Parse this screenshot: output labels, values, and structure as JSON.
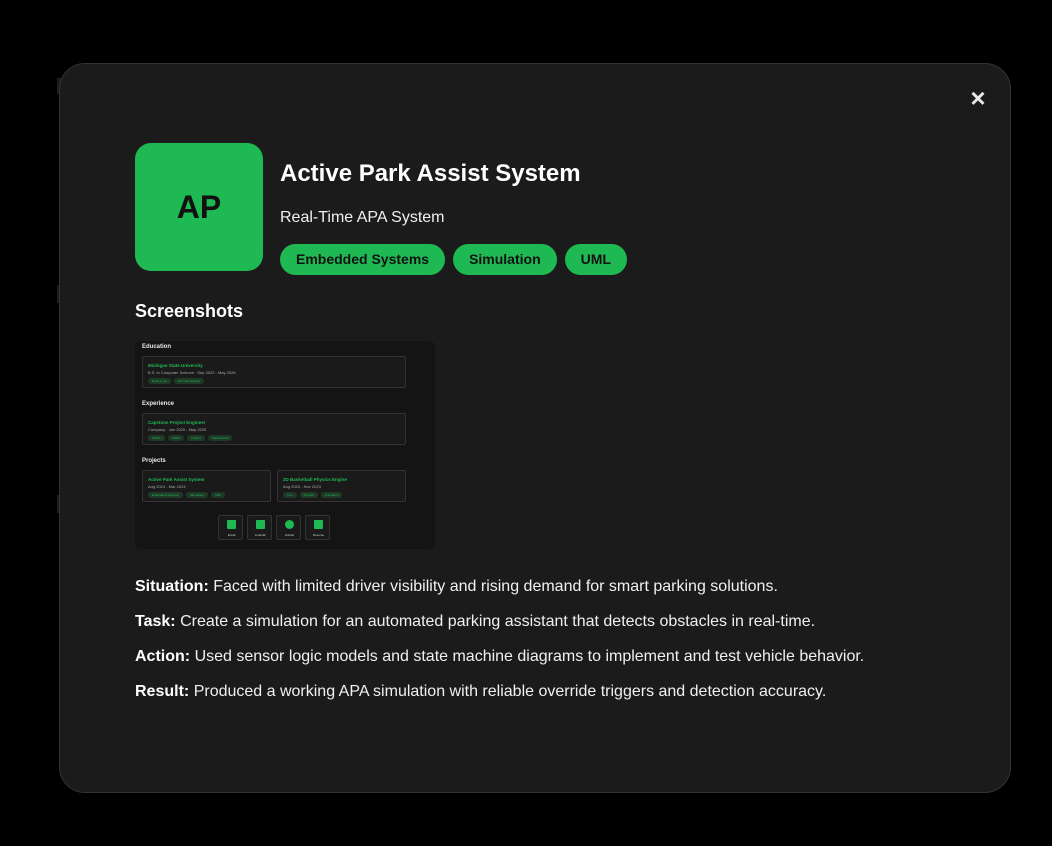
{
  "modal": {
    "close_label": "×",
    "logo_text": "AP",
    "title": "Active Park Assist System",
    "subtitle": "Real-Time APA System",
    "tags": [
      "Embedded Systems",
      "Simulation",
      "UML"
    ],
    "screenshots_heading": "Screenshots",
    "accent_color": "#1fb954"
  },
  "screenshot": {
    "education_heading": "Education",
    "education_card": {
      "title": "Michigan State University",
      "subtitle": "B.S. in Computer Science · Sep 2022 - May 2026",
      "tags": [
        "Dean's List",
        "3rd Year Student"
      ]
    },
    "experience_heading": "Experience",
    "experience_card": {
      "title": "Capstone Project Engineer",
      "subtitle": "Company · Jan 2025 - May 2025",
      "tags": [
        "CUDA",
        "ONNX",
        "Python",
        "OpenSource"
      ]
    },
    "projects_heading": "Projects",
    "project_cards": [
      {
        "title": "Active Park Assist System",
        "subtitle": "Aug 2024 - Mar 2024",
        "tags": [
          "Embedded Systems",
          "Simulation",
          "UML"
        ]
      },
      {
        "title": "2D Basketball Physics Engine",
        "subtitle": "Aug 2023 - Nov 2023",
        "tags": [
          "C++",
          "Physics",
          "Animation"
        ]
      }
    ],
    "buttons": [
      "Email",
      "LinkedIn",
      "GitHub",
      "Resume"
    ]
  },
  "star": [
    {
      "label": "Situation:",
      "text": "Faced with limited driver visibility and rising demand for smart parking solutions."
    },
    {
      "label": "Task:",
      "text": "Create a simulation for an automated parking assistant that detects obstacles in real-time."
    },
    {
      "label": "Action:",
      "text": "Used sensor logic models and state machine diagrams to implement and test vehicle behavior."
    },
    {
      "label": "Result:",
      "text": "Produced a working APA simulation with reliable override triggers and detection accuracy."
    }
  ]
}
